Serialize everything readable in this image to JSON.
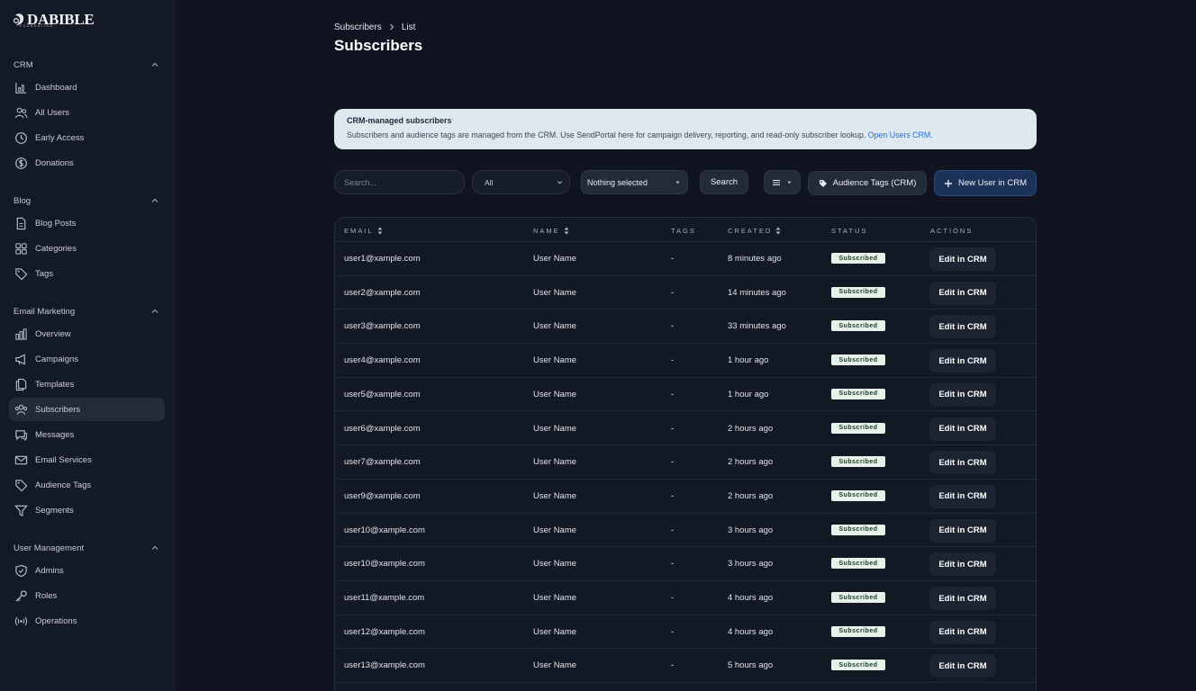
{
  "brand": {
    "name": "DABIBLE",
    "tagline": "FOUNDATION"
  },
  "sidebar": {
    "sections": [
      {
        "title": "CRM",
        "items": [
          {
            "label": "Dashboard",
            "icon": "dashboard-icon"
          },
          {
            "label": "All Users",
            "icon": "users-icon"
          },
          {
            "label": "Early Access",
            "icon": "clock-icon"
          },
          {
            "label": "Donations",
            "icon": "dollar-icon"
          }
        ]
      },
      {
        "title": "Blog",
        "items": [
          {
            "label": "Blog Posts",
            "icon": "document-icon"
          },
          {
            "label": "Categories",
            "icon": "grid-icon"
          },
          {
            "label": "Tags",
            "icon": "tag-icon"
          }
        ]
      },
      {
        "title": "Email Marketing",
        "items": [
          {
            "label": "Overview",
            "icon": "bar-chart-icon"
          },
          {
            "label": "Campaigns",
            "icon": "megaphone-icon"
          },
          {
            "label": "Templates",
            "icon": "files-icon"
          },
          {
            "label": "Subscribers",
            "icon": "user-group-icon",
            "active": true
          },
          {
            "label": "Messages",
            "icon": "chat-icon"
          },
          {
            "label": "Email Services",
            "icon": "mail-icon"
          },
          {
            "label": "Audience Tags",
            "icon": "tag-icon"
          },
          {
            "label": "Segments",
            "icon": "filter-icon"
          }
        ]
      },
      {
        "title": "User Management",
        "items": [
          {
            "label": "Admins",
            "icon": "shield-icon"
          },
          {
            "label": "Roles",
            "icon": "key-icon"
          },
          {
            "label": "Operations",
            "icon": "signal-icon"
          }
        ]
      }
    ]
  },
  "breadcrumb": {
    "parent": "Subscribers",
    "current": "List"
  },
  "page_title": "Subscribers",
  "notice": {
    "title": "CRM-managed subscribers",
    "text": "Subscribers and audience tags are managed from the CRM. Use SendPortal here for campaign delivery, reporting, and read-only subscriber lookup.",
    "link": "Open Users CRM."
  },
  "toolbar": {
    "search_placeholder": "Search...",
    "filter_value": "All",
    "tags_value": "Nothing selected",
    "search_label": "Search",
    "audience_tags_label": "Audience Tags (CRM)",
    "new_user_label": "New User in CRM"
  },
  "table": {
    "headers": {
      "email": "EMAIL",
      "name": "NAME",
      "tags": "TAGS",
      "created": "CREATED",
      "status": "STATUS",
      "actions": "ACTIONS"
    },
    "rows": [
      {
        "email": "user1@xample.com",
        "name": "User Name",
        "tags": "-",
        "created": "8 minutes ago",
        "status": "Subscribed",
        "action": "Edit in CRM"
      },
      {
        "email": "user2@xample.com",
        "name": "User Name",
        "tags": "-",
        "created": "14 minutes ago",
        "status": "Subscribed",
        "action": "Edit in CRM"
      },
      {
        "email": "user3@xample.com",
        "name": "User Name",
        "tags": "-",
        "created": "33 minutes ago",
        "status": "Subscribed",
        "action": "Edit in CRM"
      },
      {
        "email": "user4@xample.com",
        "name": "User Name",
        "tags": "-",
        "created": "1 hour ago",
        "status": "Subscribed",
        "action": "Edit in CRM"
      },
      {
        "email": "user5@xample.com",
        "name": "User Name",
        "tags": "-",
        "created": "1 hour ago",
        "status": "Subscribed",
        "action": "Edit in CRM"
      },
      {
        "email": "user6@xample.com",
        "name": "User Name",
        "tags": "-",
        "created": "2 hours ago",
        "status": "Subscribed",
        "action": "Edit in CRM"
      },
      {
        "email": "user7@xample.com",
        "name": "User Name",
        "tags": "-",
        "created": "2 hours ago",
        "status": "Subscribed",
        "action": "Edit in CRM"
      },
      {
        "email": "user9@xample.com",
        "name": "User Name",
        "tags": "-",
        "created": "2 hours ago",
        "status": "Subscribed",
        "action": "Edit in CRM"
      },
      {
        "email": "user10@xample.com",
        "name": "User Name",
        "tags": "-",
        "created": "3 hours ago",
        "status": "Subscribed",
        "action": "Edit in CRM"
      },
      {
        "email": "user10@xample.com",
        "name": "User Name",
        "tags": "-",
        "created": "3 hours ago",
        "status": "Subscribed",
        "action": "Edit in CRM"
      },
      {
        "email": "user11@xample.com",
        "name": "User Name",
        "tags": "-",
        "created": "4 hours ago",
        "status": "Subscribed",
        "action": "Edit in CRM"
      },
      {
        "email": "user12@xample.com",
        "name": "User Name",
        "tags": "-",
        "created": "4 hours ago",
        "status": "Subscribed",
        "action": "Edit in CRM"
      },
      {
        "email": "user13@xample.com",
        "name": "User Name",
        "tags": "-",
        "created": "5 hours ago",
        "status": "Subscribed",
        "action": "Edit in CRM"
      }
    ]
  },
  "colors": {
    "background": "#0f1420",
    "sidebar": "#141a25",
    "notice": "#dde8ef",
    "badge": "#e8f2ea",
    "link": "#2a6fd1"
  }
}
